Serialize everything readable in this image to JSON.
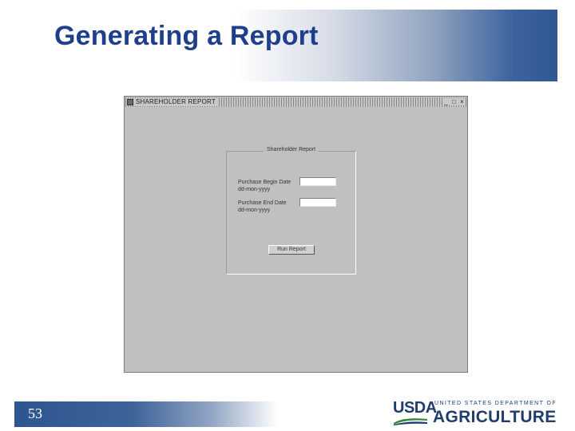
{
  "slide": {
    "title": "Generating a Report",
    "page_number": "53"
  },
  "window": {
    "title": "SHAREHOLDER REPORT",
    "controls": [
      "_",
      "□",
      "×"
    ],
    "group_label": "Shareholder Report",
    "fields": [
      {
        "label": "Purchase Begin Date",
        "format": "dd-mon-yyyy",
        "value": ""
      },
      {
        "label": "Purchase End Date",
        "format": "dd-mon-yyyy",
        "value": ""
      }
    ],
    "run_button": "Run Report"
  },
  "logo": {
    "usda": "USDA",
    "department": "UNITED STATES DEPARTMENT OF",
    "agriculture": "AGRICULTURE",
    "colors": {
      "navy": "#1f3e6e",
      "green": "#2f8a3a"
    }
  }
}
